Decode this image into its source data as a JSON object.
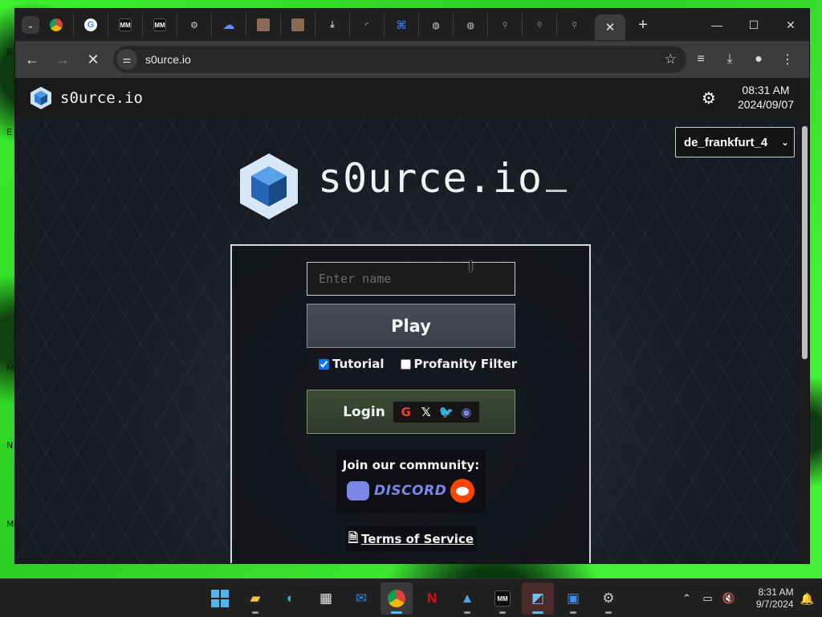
{
  "browser": {
    "tabs": [
      {
        "icon": "chrome-icon"
      },
      {
        "icon": "google-icon"
      },
      {
        "icon": "mm-icon",
        "glyph": "MM"
      },
      {
        "icon": "mm-icon",
        "glyph": "MM"
      },
      {
        "icon": "settings-icon"
      },
      {
        "icon": "cloud-icon"
      },
      {
        "icon": "image-icon"
      },
      {
        "icon": "image-icon"
      },
      {
        "icon": "download-icon"
      },
      {
        "icon": "loading-icon"
      },
      {
        "icon": "code-icon"
      },
      {
        "icon": "globe-icon"
      },
      {
        "icon": "globe-icon"
      },
      {
        "icon": "search-icon"
      },
      {
        "icon": "search-icon"
      },
      {
        "icon": "search-icon"
      }
    ],
    "url": "s0urce.io",
    "colors": {
      "tab_strip": "#1f1f1f",
      "toolbar": "#3c3c3c"
    }
  },
  "site": {
    "name": "s0urce.io",
    "time": "08:31 AM",
    "date": "2024/09/07",
    "region": "de_frankfurt_4",
    "hero_title": "s0urce.io",
    "name_placeholder": "Enter name",
    "play_label": "Play",
    "tutorial_label": "Tutorial",
    "tutorial_checked": true,
    "profanity_label": "Profanity Filter",
    "profanity_checked": false,
    "login_label": "Login",
    "login_providers": [
      "google",
      "x",
      "twitter",
      "discord"
    ],
    "community_title": "Join our community:",
    "discord_label": "DISCORD",
    "tos_label": "Terms of Service",
    "colors": {
      "accent_blue": "#2f7fd6",
      "login_green": "#3b4a35",
      "reddit": "#ff4500",
      "discord": "#7b86e8"
    }
  },
  "taskbar": {
    "apps": [
      "start",
      "file-explorer",
      "edge",
      "store",
      "outlook",
      "chrome",
      "netflix",
      "photos",
      "mm-app",
      "paint",
      "app",
      "settings"
    ],
    "time": "8:31 AM",
    "date": "9/7/2024"
  }
}
